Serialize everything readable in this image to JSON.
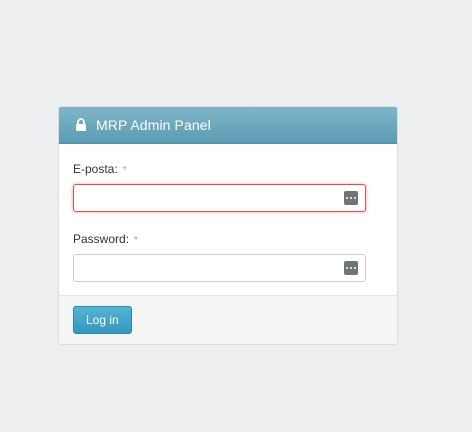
{
  "panel": {
    "title": "MRP Admin Panel",
    "icon": "lock-icon"
  },
  "form": {
    "email": {
      "label": "E-posta:",
      "required_mark": "*",
      "value": "",
      "state": "invalid",
      "addon_icon": "password-manager-icon"
    },
    "password": {
      "label": "Password:",
      "required_mark": "*",
      "value": "",
      "addon_icon": "password-manager-icon"
    },
    "submit_label": "Log in"
  },
  "colors": {
    "header": "#6aa8bd",
    "button": "#3da3c7",
    "invalid_border": "#d9534f",
    "background": "#eceef0"
  }
}
